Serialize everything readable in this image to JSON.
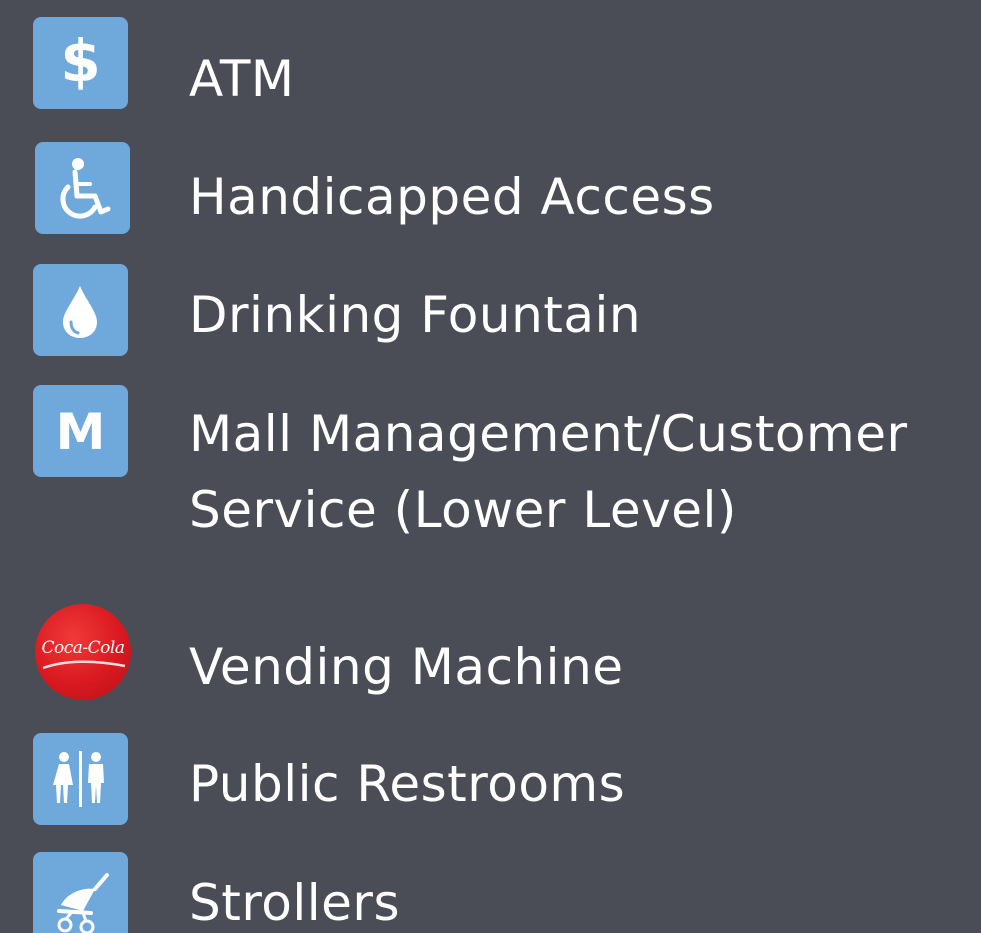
{
  "colors": {
    "background": "#4a4d55",
    "icon_tile": "#6fa9dc",
    "icon_glyph": "#ffffff",
    "coke_red": "#d91920",
    "label_text": "#ffffff"
  },
  "legend": {
    "items": [
      {
        "icon": "dollar-icon",
        "icon_glyph": "$",
        "label_lines": [
          "ATM"
        ]
      },
      {
        "icon": "wheelchair-icon",
        "label_lines": [
          "Handicapped Access"
        ]
      },
      {
        "icon": "water-drop-icon",
        "label_lines": [
          "Drinking Fountain"
        ]
      },
      {
        "icon": "letter-m-icon",
        "icon_glyph": "M",
        "label_lines": [
          "Mall Management/Customer",
          "Service (Lower Level)"
        ]
      },
      {
        "icon": "coca-cola-logo-icon",
        "icon_glyph": "Coca-Cola",
        "label_lines": [
          "Vending Machine"
        ]
      },
      {
        "icon": "restroom-icon",
        "label_lines": [
          "Public Restrooms"
        ]
      },
      {
        "icon": "stroller-icon",
        "label_lines": [
          "Strollers"
        ]
      }
    ]
  }
}
